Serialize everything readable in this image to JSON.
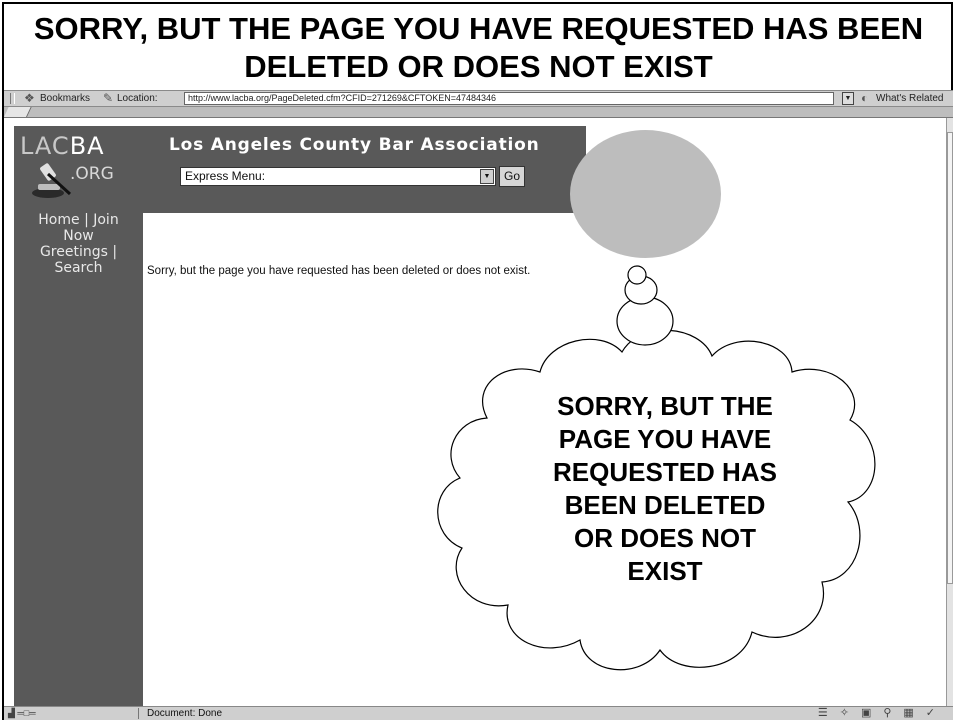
{
  "slide": {
    "heading": "SORRY, BUT THE PAGE YOU HAVE REQUESTED HAS BEEN DELETED OR DOES NOT EXIST"
  },
  "browser": {
    "bookmarks_label": "Bookmarks",
    "location_label": "Location:",
    "url": "http://www.lacba.org/PageDeleted.cfm?CFID=271269&CFTOKEN=47484346",
    "related_label": "What's Related",
    "status_text": "Document: Done"
  },
  "site": {
    "logo_lac": "LAC",
    "logo_ba": "BA",
    "logo_org": ".ORG",
    "title": "Los Angeles County Bar Association",
    "express_menu": "Express Menu:",
    "go_label": "Go",
    "nav_line1": "Home | Join",
    "nav_line2": "Now",
    "nav_line3": "Greetings |",
    "nav_line4": "Search",
    "message": "Sorry, but the page you have requested has been deleted or does not exist."
  },
  "callout": {
    "line1": "SORRY, BUT THE",
    "line2": "PAGE YOU HAVE",
    "line3": "REQUESTED HAS",
    "line4": "BEEN DELETED",
    "line5": "OR DOES NOT",
    "line6": "EXIST"
  },
  "icons": [
    "bookmarks-icon",
    "location-icon",
    "whats-related-icon",
    "gavel-icon",
    "dropdown-arrow-icon"
  ]
}
